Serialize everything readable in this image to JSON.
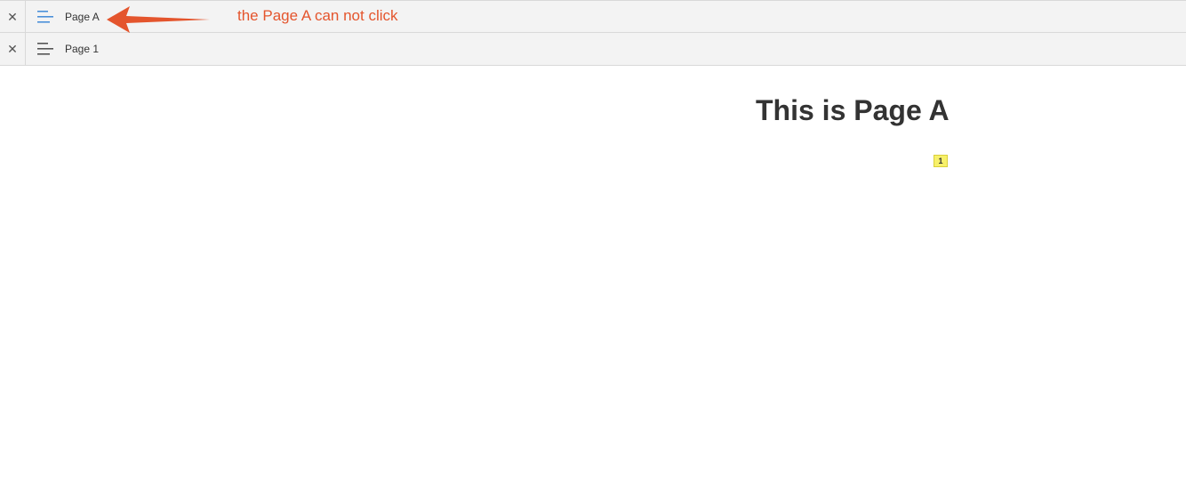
{
  "tabs": [
    {
      "label": "Page A",
      "menu_icon": "hamburger-icon",
      "close_icon": "close-icon",
      "icon_color": "#4a90d9"
    },
    {
      "label": "Page 1",
      "menu_icon": "hamburger-icon",
      "close_icon": "close-icon",
      "icon_color": "#555555"
    }
  ],
  "annotation": {
    "text": "the Page A can not click",
    "color": "#e4552d"
  },
  "content": {
    "title": "This is Page A",
    "marker": "1"
  }
}
